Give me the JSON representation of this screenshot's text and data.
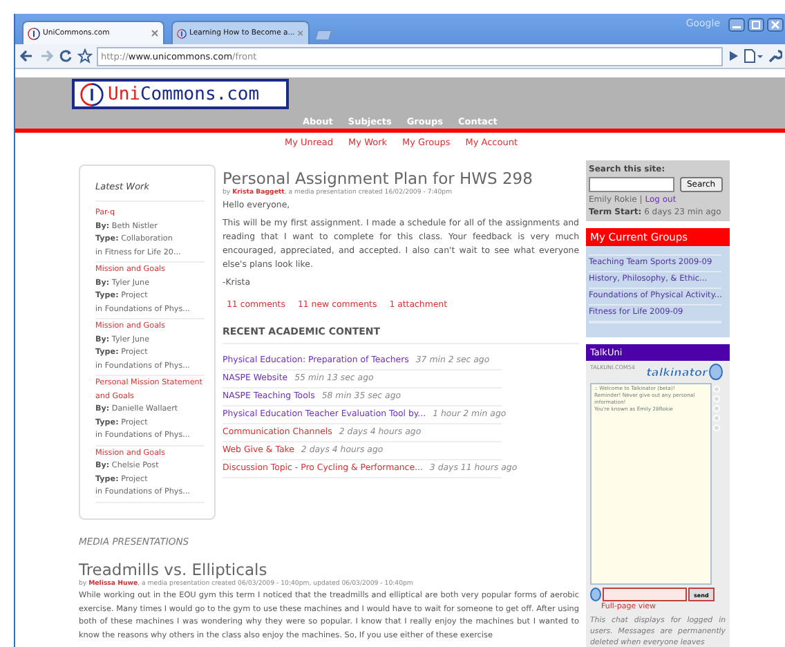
{
  "browser": {
    "tabs": [
      {
        "title": "UniCommons.com",
        "selected": true
      },
      {
        "title": "Learning How to Become a...",
        "selected": false
      }
    ],
    "corner_label": "Google",
    "url": {
      "scheme": "http://",
      "host": "www.unicommons.com",
      "path": "/front"
    }
  },
  "site": {
    "logo_prefix": "Uni",
    "logo_rest": "Commons.com",
    "nav": [
      "About",
      "Subjects",
      "Groups",
      "Contact"
    ],
    "subnav": [
      "My Unread",
      "My Work",
      "My Groups",
      "My Account"
    ]
  },
  "latest_work": {
    "title": "Latest Work",
    "items": [
      {
        "title": "Par-q",
        "by_label": "By:",
        "by": "Beth Nistler",
        "type_label": "Type:",
        "type": "Collaboration",
        "group": "in Fitness for Life 20..."
      },
      {
        "title": "Mission and Goals",
        "by_label": "By:",
        "by": "Tyler June",
        "type_label": "Type:",
        "type": "Project",
        "group": "in Foundations of Phys..."
      },
      {
        "title": "Mission and Goals",
        "by_label": "By:",
        "by": "Tyler June",
        "type_label": "Type:",
        "type": "Project",
        "group": "in Foundations of Phys..."
      },
      {
        "title": "Personal Mission Statement and Goals",
        "by_label": "By:",
        "by": "Danielle Wallaert",
        "type_label": "Type:",
        "type": "Project",
        "group": "in Foundations of Phys..."
      },
      {
        "title": "Mission and Goals",
        "by_label": "By:",
        "by": "Chelsie Post",
        "type_label": "Type:",
        "type": "Project",
        "group": "in Foundations of Phys..."
      }
    ]
  },
  "post": {
    "title": "Personal Assignment Plan for HWS 298",
    "by": "by",
    "author": "Krista Baggett",
    "meta": ", a media presentation created 16/02/2009 - 7:40pm",
    "greeting": "Hello everyone,",
    "body": "This will be my first assignment. I made a schedule for all of the assignments and reading that I want to complete for this class. Your feedback is very much encouraged, appreciated, and accepted. I also can't wait to see what everyone else's plans look like.",
    "signature": "-Krista",
    "links": [
      "11 comments",
      "11 new comments",
      "1 attachment"
    ]
  },
  "recent": {
    "heading": "RECENT ACADEMIC CONTENT",
    "items": [
      {
        "title": "Physical Education: Preparation of Teachers",
        "age": "37 min 2 sec ago",
        "visited": true
      },
      {
        "title": "NASPE Website",
        "age": "55 min 13 sec ago",
        "visited": true
      },
      {
        "title": "NASPE Teaching Tools",
        "age": "58 min 35 sec ago",
        "visited": true
      },
      {
        "title": "Physical Education Teacher Evaluation Tool by...",
        "age": "1 hour 2 min ago",
        "visited": true
      },
      {
        "title": "Communication Channels",
        "age": "2 days 4 hours ago",
        "visited": false
      },
      {
        "title": "Web Give & Take",
        "age": "2 days 4 hours ago",
        "visited": false
      },
      {
        "title": "Discussion Topic - Pro Cycling & Performance...",
        "age": "3 days 11 hours ago",
        "visited": false
      }
    ]
  },
  "media": {
    "heading": "MEDIA PRESENTATIONS",
    "title": "Treadmills vs. Ellipticals",
    "by": "by",
    "author": "Melissa Huwe",
    "meta": ", a media presentation created 06/03/2009 - 10:40pm, updated 06/03/2009 - 10:40pm",
    "body": "While working out in the EOU gym this term I noticed that the treadmills and elliptical are both very popular forms of aerobic exercise. Many times I would go to the gym to use these machines and I would have to wait for someone to get off. After using both of these machines I was wondering why they were so popular. I know that I really enjoy the machines but I wanted to know the reasons why others in the class also enjoy the machines. So, If you use either of these exercise"
  },
  "sidebar": {
    "search_label": "Search this site:",
    "search_button": "Search",
    "user": "Emily Rokie",
    "separator": "|",
    "logout": "Log out",
    "term_label": "Term Start:",
    "term": "6 days 23 min ago",
    "groups_title": "My Current Groups",
    "groups": [
      "Teaching Team Sports 2009-09",
      "History, Philosophy, & Ethic...",
      "Foundations of Physical Activity...",
      "Fitness for Life 2009-09"
    ],
    "chat": {
      "title": "TalkUni",
      "room": "TALKUNI.COM54",
      "logo": "talkinator",
      "messages": [
        ":: Welcome to Talkinator (beta)!",
        "Reminder! Never give out any personal information!",
        "You're known as Emily 28Rokie"
      ],
      "send": "send",
      "full_page": "Full-page view",
      "note": "This chat displays for logged in users. Messages are permanently deleted when everyone leaves"
    }
  }
}
